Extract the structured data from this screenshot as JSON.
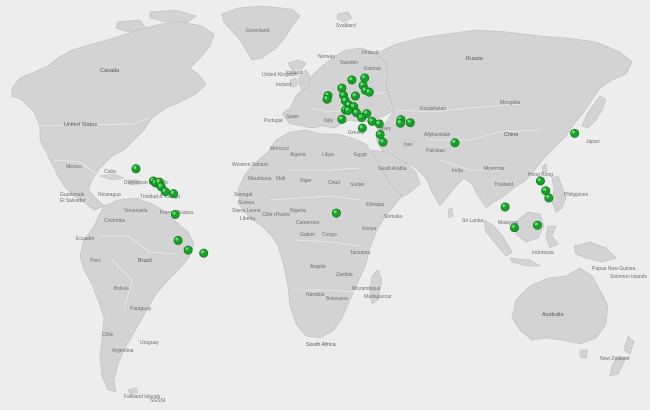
{
  "map": {
    "background_color": "#ededed",
    "land_color": "#d3d3d3",
    "marker_color": "#17a12a",
    "country_labels": {
      "greenland": "Greenland",
      "svalbard": "Svalbard",
      "iceland": "Iceland",
      "canada": "Canada",
      "united_states": "United States",
      "mexico": "Mexico",
      "cuba": "Cuba",
      "dominican_republic": "Dominican Republic",
      "guatemala": "Guatemala",
      "el_salvador": "El Salvador",
      "nicaragua": "Nicaragua",
      "trinidad": "Trinidad & Tobago",
      "colombia": "Colombia",
      "venezuela": "Venezuela",
      "french_guiana": "French Guiana",
      "ecuador": "Ecuador",
      "peru": "Peru",
      "brazil": "Brazil",
      "bolivia": "Bolivia",
      "paraguay": "Paraguay",
      "chile": "Chile",
      "argentina": "Argentina",
      "uruguay": "Uruguay",
      "falkland": "Falkland Islands",
      "sgsi": "SGSSI",
      "united_kingdom": "United Kingdom",
      "ireland": "Ireland",
      "norway": "Norway",
      "sweden": "Sweden",
      "finland": "Finland",
      "estonia": "Estonia",
      "russia": "Russia",
      "spain": "Spain",
      "portugal": "Portugal",
      "italy": "Italy",
      "greece": "Greece",
      "turkey": "Turkey",
      "morocco": "Morocco",
      "algeria": "Algeria",
      "libya": "Libya",
      "egypt": "Egypt",
      "western_sahara": "Western Sahara",
      "mauritania": "Mauritania",
      "mali": "Mali",
      "niger": "Niger",
      "chad": "Chad",
      "sudan": "Sudan",
      "senegal": "Senegal",
      "guinea": "Guinea",
      "sierra_leone": "Sierra Leone",
      "liberia": "Liberia",
      "ivory_coast": "Côte d'Ivoire",
      "nigeria": "Nigeria",
      "cameroon": "Cameroon",
      "gabon": "Gabon",
      "congo": "Congo",
      "ethiopia": "Ethiopia",
      "somalia": "Somalia",
      "kenya": "Kenya",
      "tanzania": "Tanzania",
      "angola": "Angola",
      "zambia": "Zambia",
      "namibia": "Namibia",
      "botswana": "Botswana",
      "mozambique": "Mozambique",
      "madagascar": "Madagascar",
      "south_africa": "South Africa",
      "saudi_arabia": "Saudi Arabia",
      "iran": "Iran",
      "afghanistan": "Afghanistan",
      "pakistan": "Pakistan",
      "kazakhstan": "Kazakhstan",
      "mongolia": "Mongolia",
      "china": "China",
      "india": "India",
      "sri_lanka": "Sri Lanka",
      "myanmar": "Myanmar",
      "thailand": "Thailand",
      "hong_kong": "Hong Kong",
      "philippines": "Philippines",
      "malaysia": "Malaysia",
      "indonesia": "Indonesia",
      "papua_new_guinea": "Papua New Guinea",
      "solomon": "Solomon Islands",
      "japan": "Japan",
      "australia": "Australia",
      "new_zealand": "New Zealand"
    },
    "markers": [
      {
        "location": "mexico",
        "lon": -100,
        "lat": 20
      },
      {
        "location": "guatemala",
        "lon": -90.5,
        "lat": 14.6
      },
      {
        "location": "el-salvador",
        "lon": -89.2,
        "lat": 13.7
      },
      {
        "location": "honduras",
        "lon": -87.2,
        "lat": 14.1
      },
      {
        "location": "nicaragua",
        "lon": -86.2,
        "lat": 12.1
      },
      {
        "location": "costa-rica",
        "lon": -84,
        "lat": 9.9
      },
      {
        "location": "panama",
        "lon": -79.5,
        "lat": 9
      },
      {
        "location": "ecuador",
        "lon": -78.5,
        "lat": -0.2
      },
      {
        "location": "peru-lima",
        "lon": -77,
        "lat": -12
      },
      {
        "location": "peru-south",
        "lon": -71.5,
        "lat": -16.4
      },
      {
        "location": "bolivia",
        "lon": -63,
        "lat": -17.8
      },
      {
        "location": "sweden",
        "lon": 18,
        "lat": 59.3
      },
      {
        "location": "finland",
        "lon": 25,
        "lat": 60.2
      },
      {
        "location": "denmark",
        "lon": 12.5,
        "lat": 55.7
      },
      {
        "location": "latvia",
        "lon": 24.1,
        "lat": 56.9
      },
      {
        "location": "lithuania",
        "lon": 25.3,
        "lat": 54.7
      },
      {
        "location": "belarus",
        "lon": 27.5,
        "lat": 53.9
      },
      {
        "location": "poland",
        "lon": 19.9,
        "lat": 52.2
      },
      {
        "location": "germany",
        "lon": 13.4,
        "lat": 52.5
      },
      {
        "location": "netherlands",
        "lon": 4.9,
        "lat": 52.4
      },
      {
        "location": "belgium",
        "lon": 4.4,
        "lat": 50.8
      },
      {
        "location": "czechia",
        "lon": 14.4,
        "lat": 50.1
      },
      {
        "location": "austria",
        "lon": 16.4,
        "lat": 48.2
      },
      {
        "location": "hungary",
        "lon": 19,
        "lat": 47.5
      },
      {
        "location": "slovenia",
        "lon": 14.5,
        "lat": 46
      },
      {
        "location": "croatia",
        "lon": 16,
        "lat": 45.8
      },
      {
        "location": "serbia",
        "lon": 20.5,
        "lat": 44.8
      },
      {
        "location": "romania",
        "lon": 26.1,
        "lat": 44.4
      },
      {
        "location": "bulgaria",
        "lon": 23.3,
        "lat": 42.7
      },
      {
        "location": "italy",
        "lon": 12.5,
        "lat": 41.9
      },
      {
        "location": "greece",
        "lon": 23.7,
        "lat": 38
      },
      {
        "location": "turkey-istanbul",
        "lon": 29,
        "lat": 41
      },
      {
        "location": "turkey-ankara",
        "lon": 32.9,
        "lat": 39.9
      },
      {
        "location": "georgia",
        "lon": 44.8,
        "lat": 41.7
      },
      {
        "location": "armenia",
        "lon": 44.5,
        "lat": 40.2
      },
      {
        "location": "azerbaijan",
        "lon": 49.9,
        "lat": 40.4
      },
      {
        "location": "cyprus",
        "lon": 33.4,
        "lat": 35.2
      },
      {
        "location": "israel",
        "lon": 35,
        "lat": 31.8
      },
      {
        "location": "pakistan-lahore",
        "lon": 74.3,
        "lat": 31.5
      },
      {
        "location": "gabon",
        "lon": 9.5,
        "lat": 0.4
      },
      {
        "location": "malaysia",
        "lon": 101.7,
        "lat": 3.1
      },
      {
        "location": "indonesia-jakarta",
        "lon": 106.8,
        "lat": -6.2
      },
      {
        "location": "philippines-manila",
        "lon": 121,
        "lat": 14.6
      },
      {
        "location": "philippines-cebu",
        "lon": 123.9,
        "lat": 10.3
      },
      {
        "location": "philippines-davao",
        "lon": 125.6,
        "lat": 7.1
      },
      {
        "location": "indonesia-sulawesi",
        "lon": 119.4,
        "lat": -5.1
      },
      {
        "location": "japan",
        "lon": 139.7,
        "lat": 35.7
      }
    ]
  }
}
